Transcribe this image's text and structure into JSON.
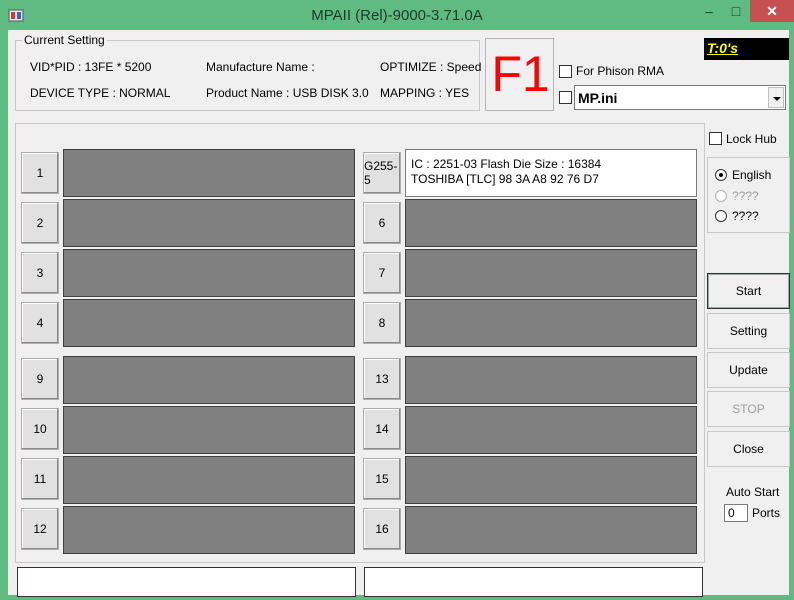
{
  "window": {
    "title": "MPAII (Rel)-9000-3.71.0A",
    "minimize": "–",
    "maximize": "□",
    "close": "✕"
  },
  "current_setting": {
    "legend": "Current Setting",
    "vid_pid": "VID*PID : 13FE * 5200",
    "device_type": "DEVICE TYPE : NORMAL",
    "manufacture": "Manufacture Name :",
    "product": "Product Name : USB DISK 3.0",
    "optimize": "OPTIMIZE : Speed",
    "mapping": "MAPPING : YES"
  },
  "f1": "F1",
  "for_phison_rma": {
    "label": "For Phison RMA",
    "checked": false
  },
  "ini_combo": {
    "value": "MP.ini",
    "checked": false
  },
  "timer": "T:0's",
  "lock_hub": {
    "label": "Lock Hub",
    "checked": false
  },
  "language": [
    {
      "label": "English",
      "selected": true,
      "enabled": true
    },
    {
      "label": "????",
      "selected": false,
      "enabled": false
    },
    {
      "label": "????",
      "selected": false,
      "enabled": true
    }
  ],
  "ports": [
    {
      "label": "1",
      "info": []
    },
    {
      "label": "G255-5",
      "info": [
        "IC : 2251-03  Flash Die Size : 16384",
        "TOSHIBA [TLC] 98 3A A8 92 76 D7"
      ]
    },
    {
      "label": "2",
      "info": []
    },
    {
      "label": "6",
      "info": []
    },
    {
      "label": "3",
      "info": []
    },
    {
      "label": "7",
      "info": []
    },
    {
      "label": "4",
      "info": []
    },
    {
      "label": "8",
      "info": []
    },
    {
      "label": "9",
      "info": []
    },
    {
      "label": "13",
      "info": []
    },
    {
      "label": "10",
      "info": []
    },
    {
      "label": "14",
      "info": []
    },
    {
      "label": "11",
      "info": []
    },
    {
      "label": "15",
      "info": []
    },
    {
      "label": "12",
      "info": []
    },
    {
      "label": "16",
      "info": []
    }
  ],
  "buttons": {
    "start": "Start",
    "setting": "Setting",
    "update": "Update",
    "stop": "STOP",
    "close": "Close"
  },
  "auto_start": {
    "label": "Auto Start",
    "value": "0",
    "ports_label": "Ports"
  },
  "colors": {
    "title_bar": "#5fbb82",
    "close_button": "#c75050",
    "port_idle": "#808080",
    "f1": "#ff0000",
    "timer_text": "#ffff00"
  }
}
